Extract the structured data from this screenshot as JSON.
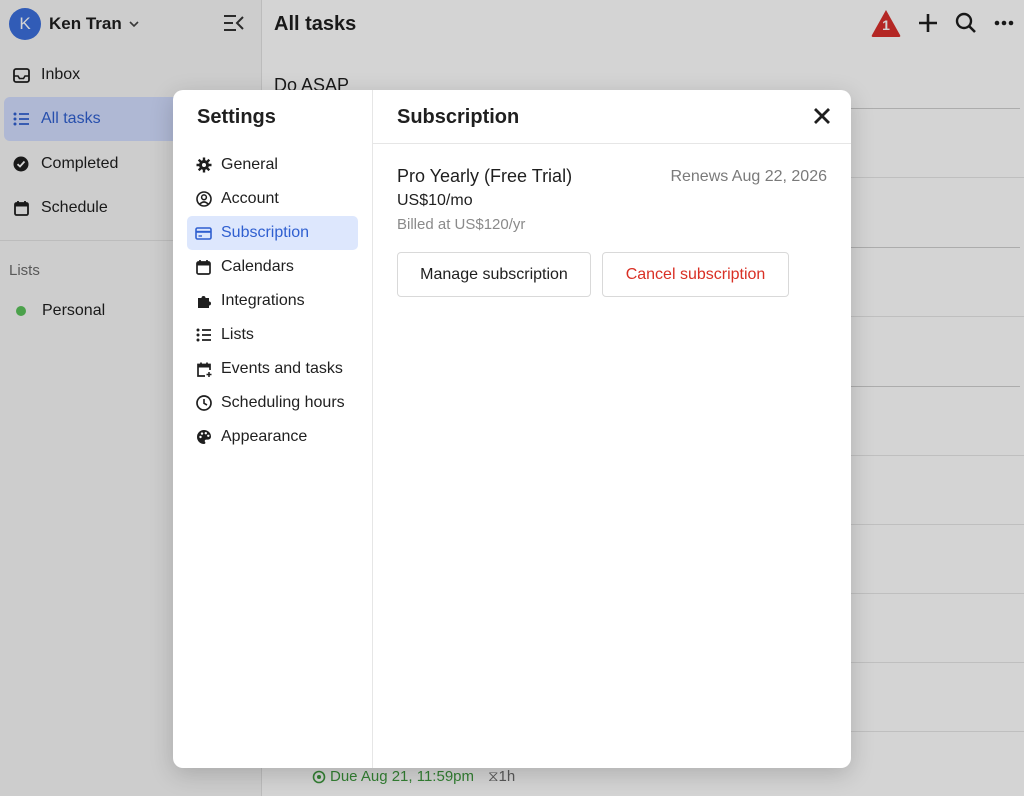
{
  "sidebar": {
    "user": {
      "initial": "K",
      "name": "Ken Tran"
    },
    "nav": [
      {
        "label": "Inbox",
        "icon": "inbox-icon"
      },
      {
        "label": "All tasks",
        "icon": "list-icon",
        "active": true
      },
      {
        "label": "Completed",
        "icon": "check-circle-icon"
      },
      {
        "label": "Schedule",
        "icon": "calendar-icon"
      }
    ],
    "lists_heading": "Lists",
    "lists": [
      {
        "label": "Personal",
        "color": "#5bc25b"
      }
    ]
  },
  "main": {
    "title": "All tasks",
    "alert_count": "1",
    "section_heading": "Do ASAP",
    "task_due": "Due Aug 21, 11:59pm",
    "task_duration": "1h"
  },
  "settings": {
    "title": "Settings",
    "items": [
      {
        "label": "General",
        "icon": "gear-icon"
      },
      {
        "label": "Account",
        "icon": "user-circle-icon"
      },
      {
        "label": "Subscription",
        "icon": "credit-card-icon",
        "active": true
      },
      {
        "label": "Calendars",
        "icon": "calendar-icon"
      },
      {
        "label": "Integrations",
        "icon": "puzzle-icon"
      },
      {
        "label": "Lists",
        "icon": "list-icon"
      },
      {
        "label": "Events and tasks",
        "icon": "calendar-plus-icon"
      },
      {
        "label": "Scheduling hours",
        "icon": "clock-icon"
      },
      {
        "label": "Appearance",
        "icon": "palette-icon"
      }
    ]
  },
  "subscription": {
    "title": "Subscription",
    "plan": "Pro Yearly (Free Trial)",
    "renews": "Renews Aug 22, 2026",
    "price": "US$10/mo",
    "billed": "Billed at US$120/yr",
    "manage_label": "Manage subscription",
    "cancel_label": "Cancel subscription"
  },
  "colors": {
    "accent": "#2f5fd0",
    "danger": "#d93025",
    "alert": "#d9302c"
  }
}
